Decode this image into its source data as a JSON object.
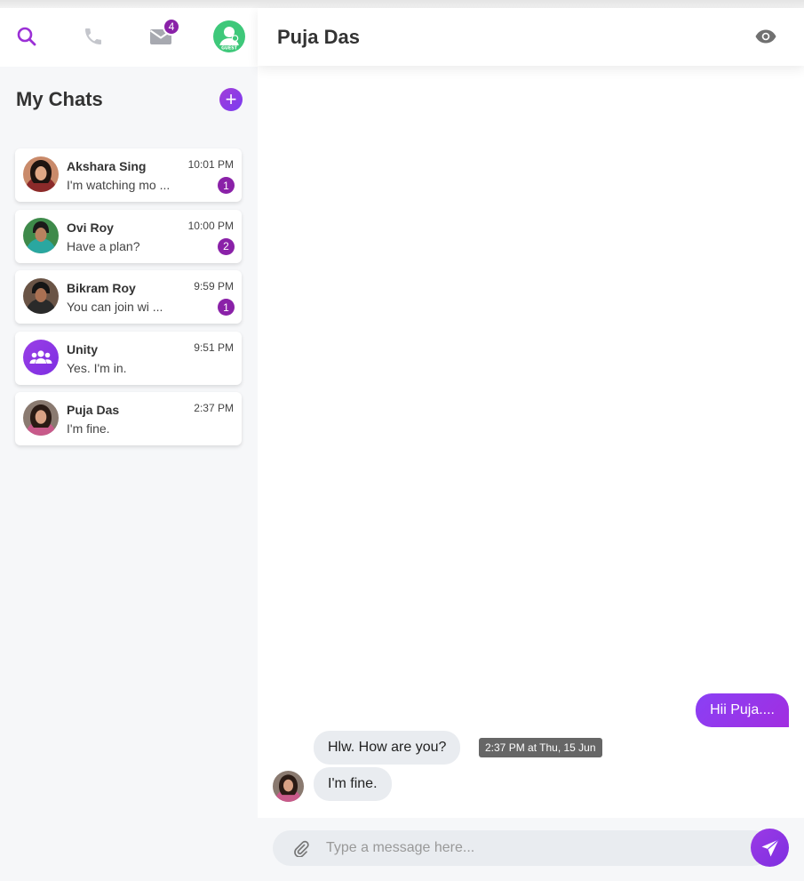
{
  "nav": {
    "mail_badge": "4",
    "avatar_label": "GUEST"
  },
  "sidebar": {
    "title": "My Chats",
    "add_label": "+",
    "chats": [
      {
        "name": "Akshara Sing",
        "preview": "I'm watching mo ...",
        "time": "10:01 PM",
        "unread": "1"
      },
      {
        "name": "Ovi Roy",
        "preview": "Have a plan?",
        "time": "10:00 PM",
        "unread": "2"
      },
      {
        "name": "Bikram Roy",
        "preview": "You can join wi ...",
        "time": "9:59 PM",
        "unread": "1"
      },
      {
        "name": "Unity",
        "preview": "Yes. I'm in.",
        "time": "9:51 PM",
        "unread": ""
      },
      {
        "name": "Puja Das",
        "preview": "I'm fine.",
        "time": "2:37 PM",
        "unread": ""
      }
    ]
  },
  "main": {
    "title": "Puja Das",
    "messages": {
      "outgoing": "Hii Puja....",
      "incoming_1": "Hlw. How are you?",
      "incoming_2": "I'm fine.",
      "timestamp": "2:37 PM at Thu, 15 Jun"
    },
    "composer": {
      "placeholder": "Type a message here..."
    }
  },
  "colors": {
    "accent": "#8a21a8",
    "send": "#8a40f5",
    "guest_avatar": "#3ec87a"
  }
}
